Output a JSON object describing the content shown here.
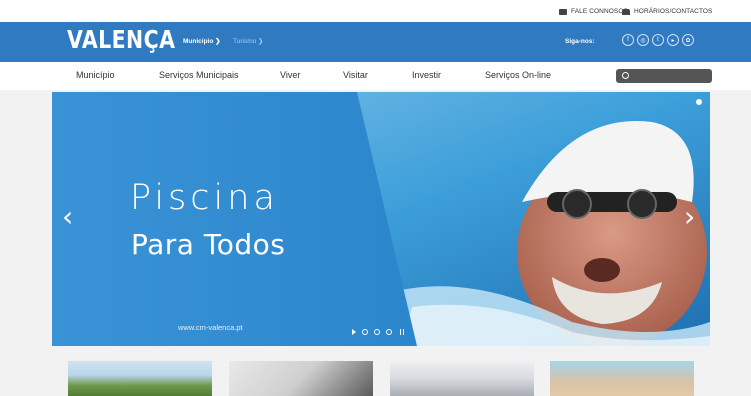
{
  "utility": {
    "contact": "FALE CONNOSCO",
    "hours": "HORÁRIOS/CONTACTOS"
  },
  "header": {
    "logo": "VALENÇA",
    "breadcrumb": [
      "Município",
      "Turismo"
    ],
    "follow_label": "Siga-nos:",
    "social_icons": [
      "facebook-icon",
      "instagram-icon",
      "twitter-icon",
      "youtube-icon",
      "other-icon"
    ],
    "color": "#2f7ac0"
  },
  "nav": {
    "items": [
      "Município",
      "Serviços Municipais",
      "Viver",
      "Visitar",
      "Investir",
      "Serviços On-line"
    ]
  },
  "slider": {
    "title": "Piscina",
    "subtitle": "Para Todos",
    "url": "www.cm-valenca.pt",
    "slide_count": 3
  },
  "thumbnails": [
    "landscape",
    "signing-document",
    "people",
    "family"
  ]
}
